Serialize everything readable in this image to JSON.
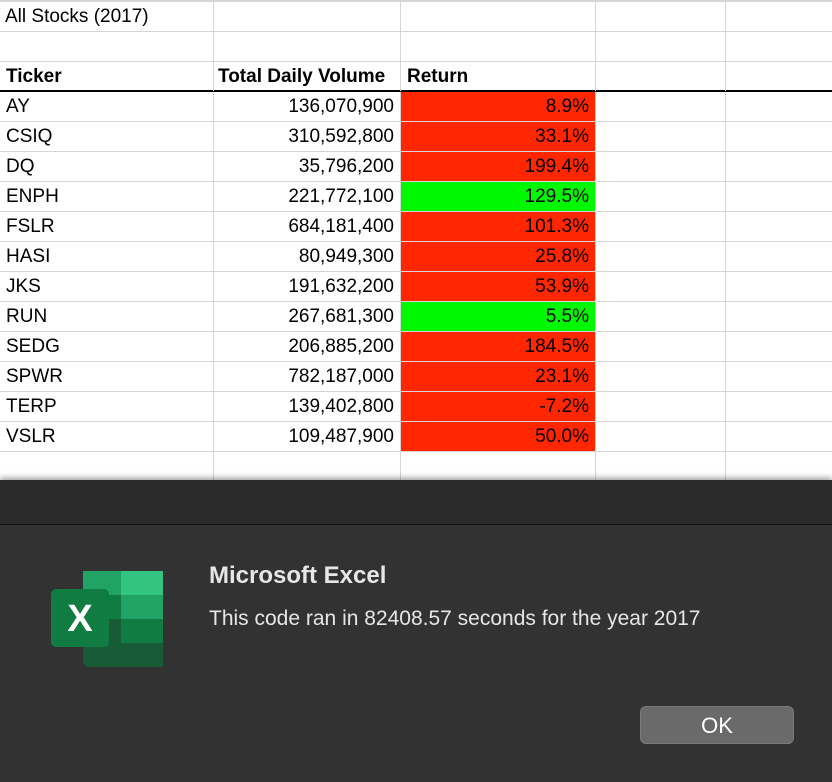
{
  "sheet": {
    "title": "All Stocks (2017)",
    "headers": {
      "ticker": "Ticker",
      "volume": "Total Daily Volume",
      "return": "Return"
    },
    "rows": [
      {
        "ticker": "AY",
        "volume": "136,070,900",
        "return": "8.9%",
        "status": "negative"
      },
      {
        "ticker": "CSIQ",
        "volume": "310,592,800",
        "return": "33.1%",
        "status": "negative"
      },
      {
        "ticker": "DQ",
        "volume": "35,796,200",
        "return": "199.4%",
        "status": "negative"
      },
      {
        "ticker": "ENPH",
        "volume": "221,772,100",
        "return": "129.5%",
        "status": "positive"
      },
      {
        "ticker": "FSLR",
        "volume": "684,181,400",
        "return": "101.3%",
        "status": "negative"
      },
      {
        "ticker": "HASI",
        "volume": "80,949,300",
        "return": "25.8%",
        "status": "negative"
      },
      {
        "ticker": "JKS",
        "volume": "191,632,200",
        "return": "53.9%",
        "status": "negative"
      },
      {
        "ticker": "RUN",
        "volume": "267,681,300",
        "return": "5.5%",
        "status": "positive"
      },
      {
        "ticker": "SEDG",
        "volume": "206,885,200",
        "return": "184.5%",
        "status": "negative"
      },
      {
        "ticker": "SPWR",
        "volume": "782,187,000",
        "return": "23.1%",
        "status": "negative"
      },
      {
        "ticker": "TERP",
        "volume": "139,402,800",
        "return": "-7.2%",
        "status": "negative"
      },
      {
        "ticker": "VSLR",
        "volume": "109,487,900",
        "return": "50.0%",
        "status": "negative"
      }
    ],
    "colors": {
      "negative_fill": "#ff2600",
      "positive_fill": "#00f900"
    }
  },
  "dialog": {
    "app_name": "Microsoft Excel",
    "message": "This code ran in 82408.57 seconds for the year 2017",
    "ok_label": "OK",
    "icon": "excel-icon",
    "icon_letter": "X"
  }
}
